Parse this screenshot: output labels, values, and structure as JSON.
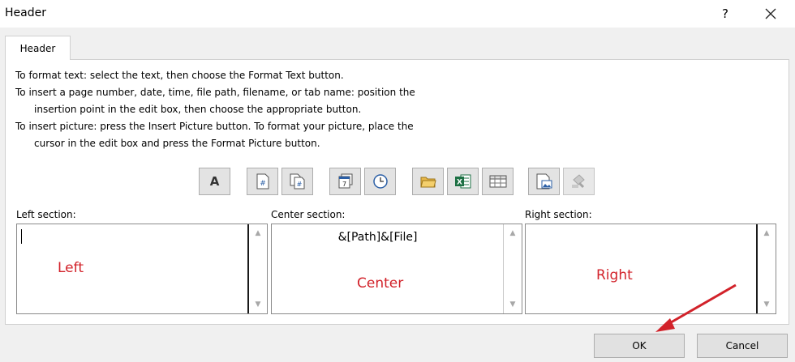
{
  "window": {
    "title": "Header",
    "help_glyph": "?",
    "close_icon": "close-icon"
  },
  "tab": {
    "label": "Header"
  },
  "instructions": [
    "To format text:  select the text, then choose the Format Text button.",
    "To insert a page number, date, time, file path, filename, or tab name:  position the",
    "insertion point in the edit box, then choose the appropriate button.",
    "To insert picture: press the Insert Picture button.  To format your picture, place the",
    "cursor in the edit box and press the Format Picture button."
  ],
  "toolbar": {
    "format_text_glyph": "A",
    "buttons": [
      "format-text-icon",
      "page-number-icon",
      "number-of-pages-icon",
      "date-icon",
      "time-icon",
      "file-path-icon",
      "file-name-icon",
      "sheet-name-icon",
      "insert-picture-icon",
      "format-picture-icon"
    ]
  },
  "sections": {
    "left": {
      "label": "Left section:",
      "content": "",
      "note": "Left"
    },
    "center": {
      "label": "Center section:",
      "content": "&[Path]&[File]",
      "note": "Center"
    },
    "right": {
      "label": "Right section:",
      "content": "",
      "note": "Right"
    }
  },
  "buttons": {
    "ok": "OK",
    "cancel": "Cancel"
  },
  "colors": {
    "annotation": "#d2222a",
    "excel_green": "#1d7044"
  }
}
